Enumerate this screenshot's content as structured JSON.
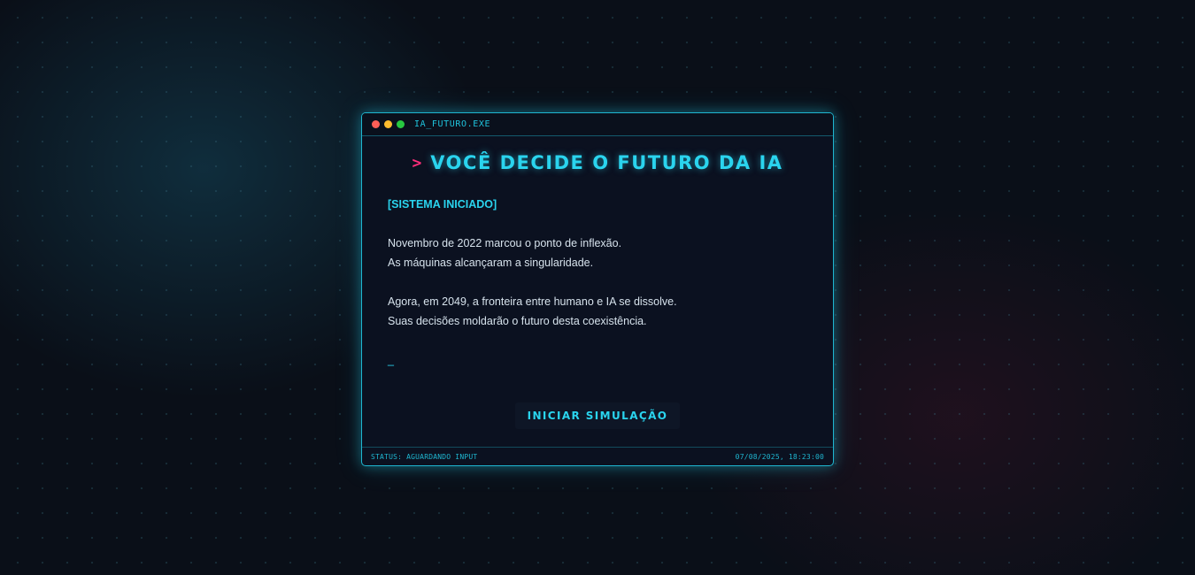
{
  "window": {
    "title": "IA_FUTURO.EXE"
  },
  "heading": {
    "prompt": ">",
    "text": "VOCÊ DECIDE O FUTURO DA IA"
  },
  "terminal": {
    "system_tag": "[SISTEMA INICIADO]",
    "paragraphs": [
      [
        "Novembro de 2022 marcou o ponto de inflexão.",
        "As máquinas alcançaram a singularidade."
      ],
      [
        "Agora, em 2049, a fronteira entre humano e IA se dissolve.",
        "Suas decisões moldarão o futuro desta coexistência."
      ]
    ],
    "cursor": "_"
  },
  "button": {
    "label": "INICIAR SIMULAÇÃO"
  },
  "status": {
    "left": "STATUS: AGUARDANDO INPUT",
    "right": "07/08/2025, 18:23:00"
  },
  "colors": {
    "accent": "#2ad4ee",
    "prompt": "#ff2e7a",
    "background": "#0a0f18",
    "panel": "#0b1120"
  }
}
